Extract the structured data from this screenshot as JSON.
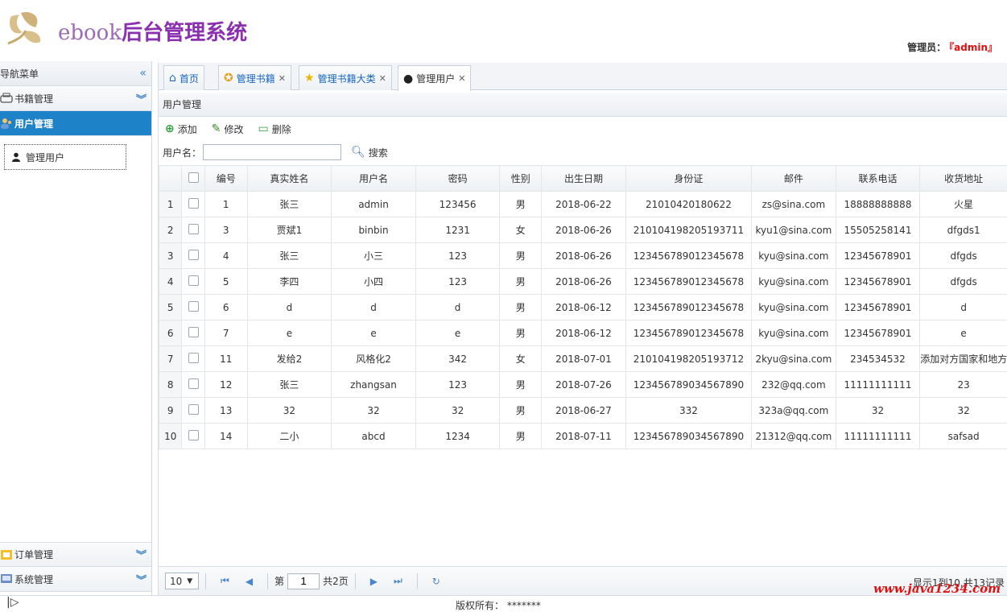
{
  "header": {
    "logo_en": "ebook",
    "logo_cn": "后台管理系统",
    "admin_label": "管理员：",
    "admin_name": "『admin』"
  },
  "sidebar": {
    "nav_title": "导航菜单",
    "groups": [
      {
        "label": "书籍管理",
        "active": false
      },
      {
        "label": "用户管理",
        "active": true
      },
      {
        "label": "订单管理",
        "active": false
      },
      {
        "label": "系统管理",
        "active": false
      }
    ],
    "active_items": [
      "管理用户"
    ]
  },
  "tabs": [
    {
      "label": "首页",
      "closable": false,
      "active": false
    },
    {
      "label": "管理书籍",
      "closable": true,
      "active": false
    },
    {
      "label": "管理书籍大类",
      "closable": true,
      "active": false
    },
    {
      "label": "管理用户",
      "closable": true,
      "active": true
    }
  ],
  "panel": {
    "title": "用户管理",
    "toolbar": {
      "add": "添加",
      "edit": "修改",
      "delete": "删除"
    },
    "search": {
      "label": "用户名：",
      "value": "",
      "button": "搜索"
    }
  },
  "table": {
    "columns": [
      "编号",
      "真实姓名",
      "用户名",
      "密码",
      "性别",
      "出生日期",
      "身份证",
      "邮件",
      "联系电话",
      "收货地址"
    ],
    "rows": [
      [
        "1",
        "张三",
        "admin",
        "123456",
        "男",
        "2018-06-22",
        "21010420180622",
        "zs@sina.com",
        "18888888888",
        "火星"
      ],
      [
        "3",
        "贾斌1",
        "binbin",
        "1231",
        "女",
        "2018-06-26",
        "210104198205193711",
        "kyu1@sina.com",
        "15505258141",
        "dfgds1"
      ],
      [
        "4",
        "张三",
        "小三",
        "123",
        "男",
        "2018-06-26",
        "123456789012345678",
        "kyu@sina.com",
        "12345678901",
        "dfgds"
      ],
      [
        "5",
        "李四",
        "小四",
        "123",
        "男",
        "2018-06-26",
        "123456789012345678",
        "kyu@sina.com",
        "12345678901",
        "dfgds"
      ],
      [
        "6",
        "d",
        "d",
        "d",
        "男",
        "2018-06-12",
        "123456789012345678",
        "kyu@sina.com",
        "12345678901",
        "d"
      ],
      [
        "7",
        "e",
        "e",
        "e",
        "男",
        "2018-06-12",
        "123456789012345678",
        "kyu@sina.com",
        "12345678901",
        "e"
      ],
      [
        "11",
        "发给2",
        "风格化2",
        "342",
        "女",
        "2018-07-01",
        "210104198205193712",
        "2kyu@sina.com",
        "234534532",
        "添加对方国家和地方"
      ],
      [
        "12",
        "张三",
        "zhangsan",
        "123",
        "男",
        "2018-07-26",
        "123456789034567890",
        "232@qq.com",
        "11111111111",
        "23"
      ],
      [
        "13",
        "32",
        "32",
        "32",
        "男",
        "2018-06-27",
        "332",
        "323a@qq.com",
        "32",
        "32"
      ],
      [
        "14",
        "二小",
        "abcd",
        "1234",
        "男",
        "2018-07-11",
        "123456789034567890",
        "21312@qq.com",
        "11111111111",
        "safsad"
      ]
    ]
  },
  "pager": {
    "page_size": "10",
    "page_prefix": "第",
    "current_page": "1",
    "page_suffix": "共2页",
    "info": "显示1到10,共13记录"
  },
  "footer": {
    "copyright": "版权所有： *******",
    "watermark": "www.java1234.com"
  },
  "colors": {
    "accent": "#1e82c8",
    "brand": "#8a2fb0",
    "admin_name": "#e01010"
  }
}
